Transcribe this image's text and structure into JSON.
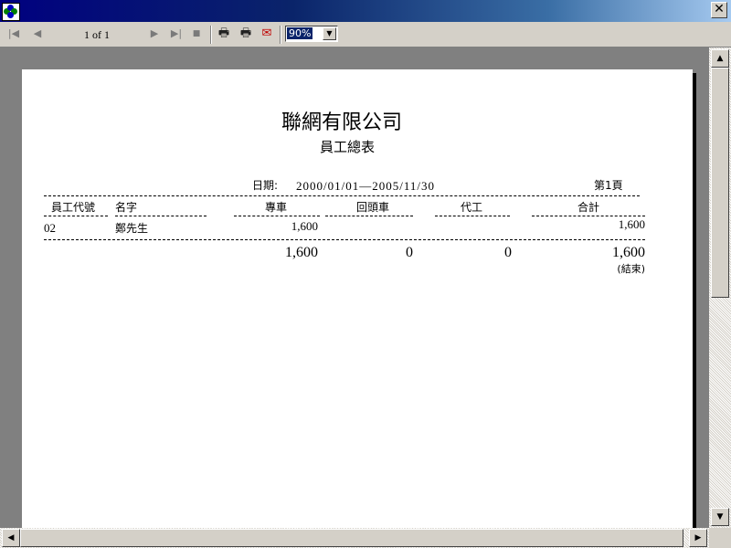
{
  "window": {
    "close_glyph": "✕"
  },
  "toolbar": {
    "first_icon": "first-page-icon",
    "prev_icon": "prev-page-icon",
    "page_indicator": "1 of 1",
    "next_icon": "next-page-icon",
    "last_icon": "last-page-icon",
    "stop_icon": "stop-icon",
    "print_icon": "printer-icon",
    "print_setup_icon": "print-setup-icon",
    "export_icon": "export-icon",
    "zoom": {
      "selected": "90%"
    }
  },
  "report": {
    "company": "聯網有限公司",
    "title": "員工總表",
    "date_label": "日期:",
    "date_range": "2000/01/01—2005/11/30",
    "page_label": "第1頁",
    "columns": {
      "emp_id": "員工代號",
      "name": "名字",
      "dedicated": "專車",
      "return": "回頭車",
      "substitute": "代工",
      "total": "合計"
    },
    "rows": [
      {
        "emp_id": "02",
        "name": "鄭先生",
        "dedicated": "1,600",
        "return": "",
        "substitute": "",
        "total": "1,600"
      }
    ],
    "totals": {
      "dedicated": "1,600",
      "return": "0",
      "substitute": "0",
      "total": "1,600"
    },
    "end_label": "(結束)"
  }
}
